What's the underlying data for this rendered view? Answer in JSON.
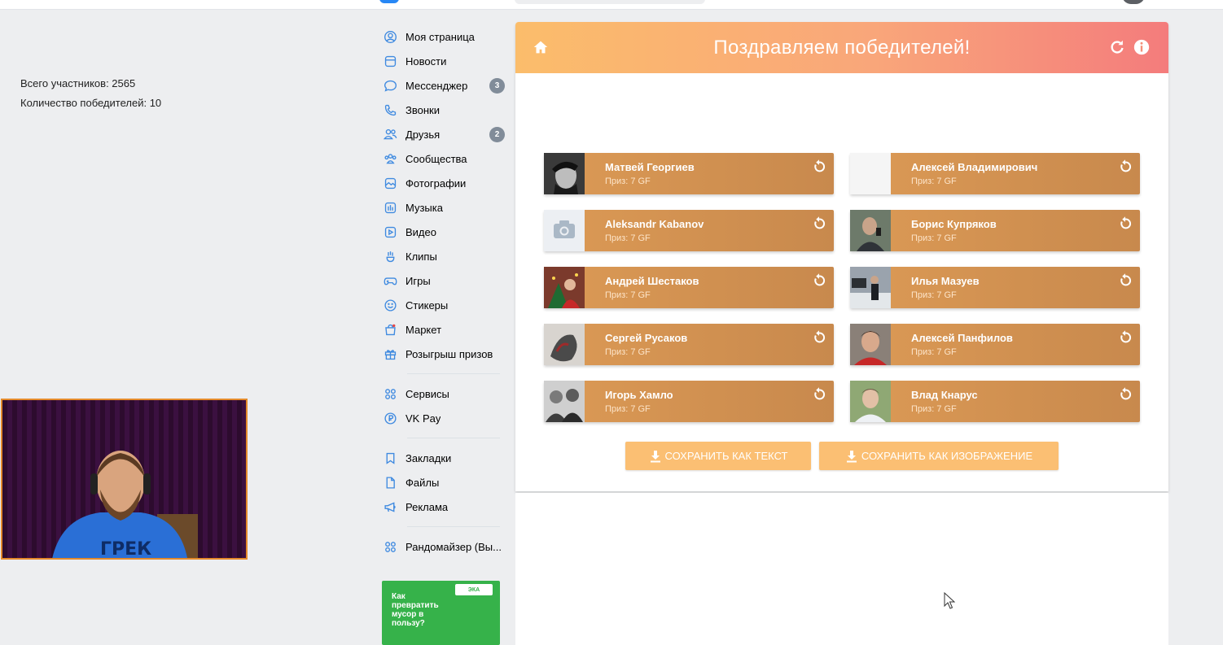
{
  "nav": {
    "items": [
      {
        "label": "Моя страница",
        "icon": "user-circle-icon"
      },
      {
        "label": "Новости",
        "icon": "news-icon"
      },
      {
        "label": "Мессенджер",
        "icon": "chat-icon",
        "badge": "3"
      },
      {
        "label": "Звонки",
        "icon": "phone-icon"
      },
      {
        "label": "Друзья",
        "icon": "friends-icon",
        "badge": "2"
      },
      {
        "label": "Сообщества",
        "icon": "communities-icon"
      },
      {
        "label": "Фотографии",
        "icon": "photos-icon"
      },
      {
        "label": "Музыка",
        "icon": "music-icon"
      },
      {
        "label": "Видео",
        "icon": "video-icon"
      },
      {
        "label": "Клипы",
        "icon": "clips-icon"
      },
      {
        "label": "Игры",
        "icon": "gamepad-icon"
      },
      {
        "label": "Стикеры",
        "icon": "smile-icon"
      },
      {
        "label": "Маркет",
        "icon": "market-bag-icon"
      },
      {
        "label": "Розыгрыш призов",
        "icon": "gift-icon"
      }
    ],
    "group2": [
      {
        "label": "Сервисы",
        "icon": "services-icon"
      },
      {
        "label": "VK Pay",
        "icon": "vkpay-icon"
      }
    ],
    "group3": [
      {
        "label": "Закладки",
        "icon": "bookmark-icon"
      },
      {
        "label": "Файлы",
        "icon": "file-icon"
      },
      {
        "label": "Реклама",
        "icon": "megaphone-icon"
      }
    ],
    "group4": [
      {
        "label": "Рандомайзер (Вы...",
        "icon": "apps-icon"
      }
    ]
  },
  "ad": {
    "text": "Как превратить мусор в пользу?",
    "logo": "ЭКА"
  },
  "panel": {
    "title": "Поздравляем победителей!",
    "total_participants": "Всего участников: 2565",
    "winners_count": "Количество победителей: 10"
  },
  "winners": [
    {
      "name": "Матвей Георгиев",
      "prize": "Приз: 7 GF"
    },
    {
      "name": "Алексей Владимирович",
      "prize": "Приз: 7 GF"
    },
    {
      "name": "Aleksandr Kabanov",
      "prize": "Приз: 7 GF"
    },
    {
      "name": "Борис Купряков",
      "prize": "Приз: 7 GF"
    },
    {
      "name": "Андрей Шестаков",
      "prize": "Приз: 7 GF"
    },
    {
      "name": "Илья Мазуев",
      "prize": "Приз: 7 GF"
    },
    {
      "name": "Сергей Русаков",
      "prize": "Приз: 7 GF"
    },
    {
      "name": "Алексей Панфилов",
      "prize": "Приз: 7 GF"
    },
    {
      "name": "Игорь Хамло",
      "prize": "Приз: 7 GF"
    },
    {
      "name": "Влад Кнарус",
      "prize": "Приз: 7 GF"
    }
  ],
  "buttons": {
    "save_text": "СОХРАНИТЬ КАК ТЕКСТ",
    "save_image": "СОХРАНИТЬ КАК ИЗОБРАЖЕНИЕ"
  },
  "colors": {
    "accent": "#3f8ae0",
    "header_start": "#fbbd6b",
    "header_end": "#f47c7c",
    "card": "#d49350",
    "button": "#fbbf73"
  }
}
